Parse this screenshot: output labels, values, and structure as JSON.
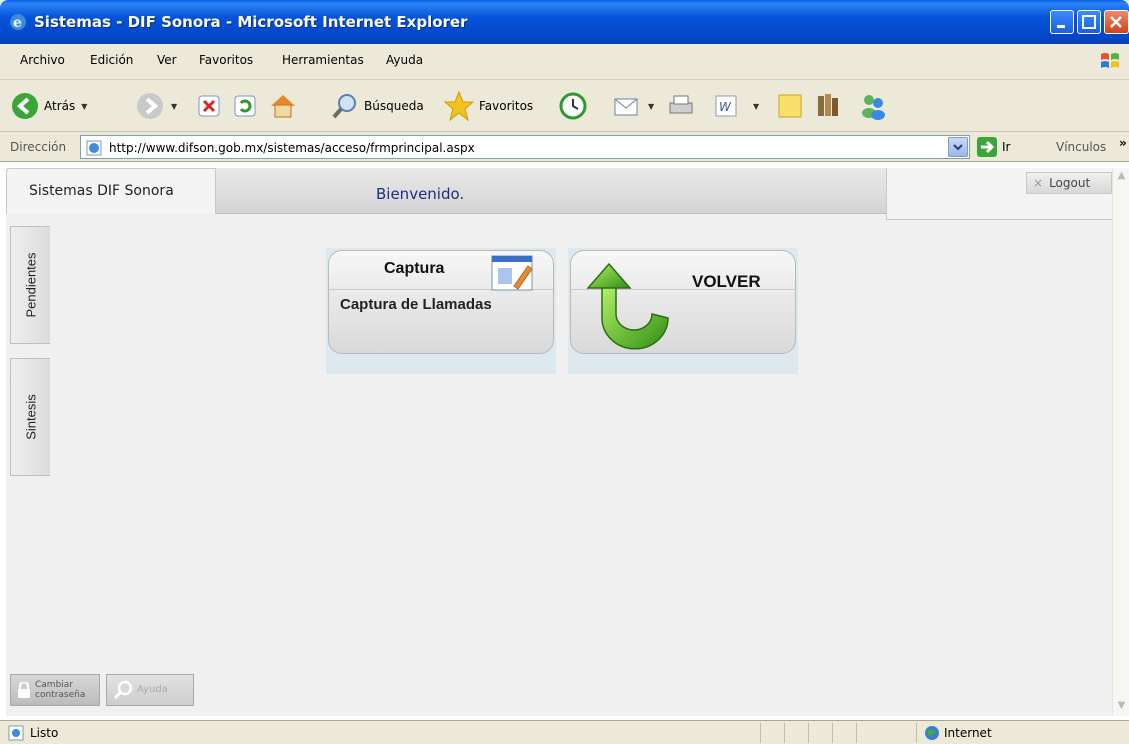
{
  "window": {
    "title": "Sistemas - DIF Sonora - Microsoft Internet Explorer"
  },
  "menu": {
    "items": [
      "Archivo",
      "Edición",
      "Ver",
      "Favoritos",
      "Herramientas",
      "Ayuda"
    ]
  },
  "toolbar": {
    "back_label": "Atrás",
    "search_label": "Búsqueda",
    "favorites_label": "Favoritos"
  },
  "address": {
    "label": "Dirección",
    "url": "http://www.difson.gob.mx/sistemas/acceso/frmprincipal.aspx",
    "go_label": "Ir",
    "links_label": "Vínculos"
  },
  "app": {
    "tab_title": "Sistemas DIF Sonora",
    "welcome": "Bienvenido.",
    "logout_label": "Logout",
    "side_tabs": [
      "Pendientes",
      "Sintesis"
    ],
    "cards": [
      {
        "title": "Captura",
        "subtitle": "Captura de Llamadas"
      },
      {
        "title": "VOLVER"
      }
    ],
    "change_password_label": "Cambiar contraseña",
    "help_label": "Ayuda"
  },
  "status": {
    "text": "Listo",
    "zone": "Internet"
  },
  "colors": {
    "title_bar": "#0553d8",
    "welcome_text": "#1b2f80",
    "card_accent": "#dde9ee"
  },
  "icons": [
    "ie-logo-icon",
    "minimize-icon",
    "maximize-icon",
    "close-icon",
    "windows-flag-icon",
    "back-arrow-icon",
    "forward-arrow-icon",
    "stop-icon",
    "refresh-icon",
    "home-icon",
    "search-icon",
    "favorites-star-icon",
    "history-icon",
    "mail-icon",
    "print-icon",
    "word-icon",
    "notes-icon",
    "research-icon",
    "messenger-icon",
    "page-icon",
    "go-arrow-icon",
    "edit-pencil-icon",
    "return-arrow-icon",
    "lock-icon",
    "magnifier-icon",
    "globe-icon"
  ]
}
